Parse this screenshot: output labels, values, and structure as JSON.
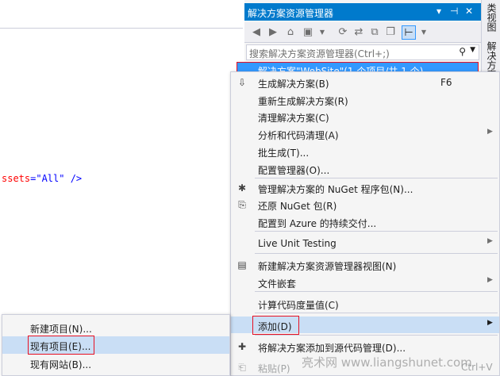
{
  "editor": {
    "code_attr": "ssets",
    "code_eq": "=",
    "code_val": "\"All\"",
    "code_end": " />"
  },
  "vertical_tabs": [
    "类视图",
    "解决方案"
  ],
  "solution_explorer": {
    "title": "解决方案资源管理器",
    "title_buttons": [
      "▾",
      "⊣",
      "✕"
    ],
    "search_placeholder": "搜索解决方案资源管理器(Ctrl+;)",
    "node_label": "解决方案\"WebSite\"(1 个项目/共 1 个)"
  },
  "context_menu": {
    "items": [
      {
        "label": "生成解决方案(B)",
        "shortcut": "F6",
        "icon": "build-icon"
      },
      {
        "label": "重新生成解决方案(R)",
        "shortcut": "",
        "icon": ""
      },
      {
        "label": "清理解决方案(C)",
        "shortcut": "",
        "icon": ""
      },
      {
        "label": "分析和代码清理(A)",
        "shortcut": "",
        "icon": "",
        "submenu": true
      },
      {
        "label": "批生成(T)...",
        "shortcut": "",
        "icon": ""
      },
      {
        "label": "配置管理器(O)...",
        "shortcut": "",
        "icon": ""
      },
      {
        "label": "管理解决方案的 NuGet 程序包(N)...",
        "shortcut": "",
        "icon": "nuget-icon"
      },
      {
        "label": "还原 NuGet 包(R)",
        "shortcut": "",
        "icon": "restore-icon"
      },
      {
        "label": "配置到 Azure 的持续交付...",
        "shortcut": "",
        "icon": ""
      },
      {
        "label": "Live Unit Testing",
        "shortcut": "",
        "icon": "",
        "submenu": true
      },
      {
        "label": "新建解决方案资源管理器视图(N)",
        "shortcut": "",
        "icon": "new-view-icon"
      },
      {
        "label": "文件嵌套",
        "shortcut": "",
        "icon": "",
        "submenu": true
      },
      {
        "label": "计算代码度量值(C)",
        "shortcut": "",
        "icon": ""
      },
      {
        "label": "添加(D)",
        "shortcut": "",
        "icon": "",
        "submenu": true
      },
      {
        "label": "将解决方案添加到源代码管理(D)...",
        "shortcut": "",
        "icon": "source-control-icon"
      },
      {
        "label": "粘贴(P)",
        "shortcut": "Ctrl+V",
        "icon": "paste-icon"
      }
    ]
  },
  "add_submenu": {
    "items": [
      "新建项目(N)...",
      "现有项目(E)...",
      "现有网站(B)..."
    ]
  },
  "watermark": "亮术网 www.liangshunet.com",
  "colors": {
    "accent": "#007acc",
    "highlight": "#c9def5",
    "selection": "#3399ff",
    "callout": "#e81123"
  }
}
